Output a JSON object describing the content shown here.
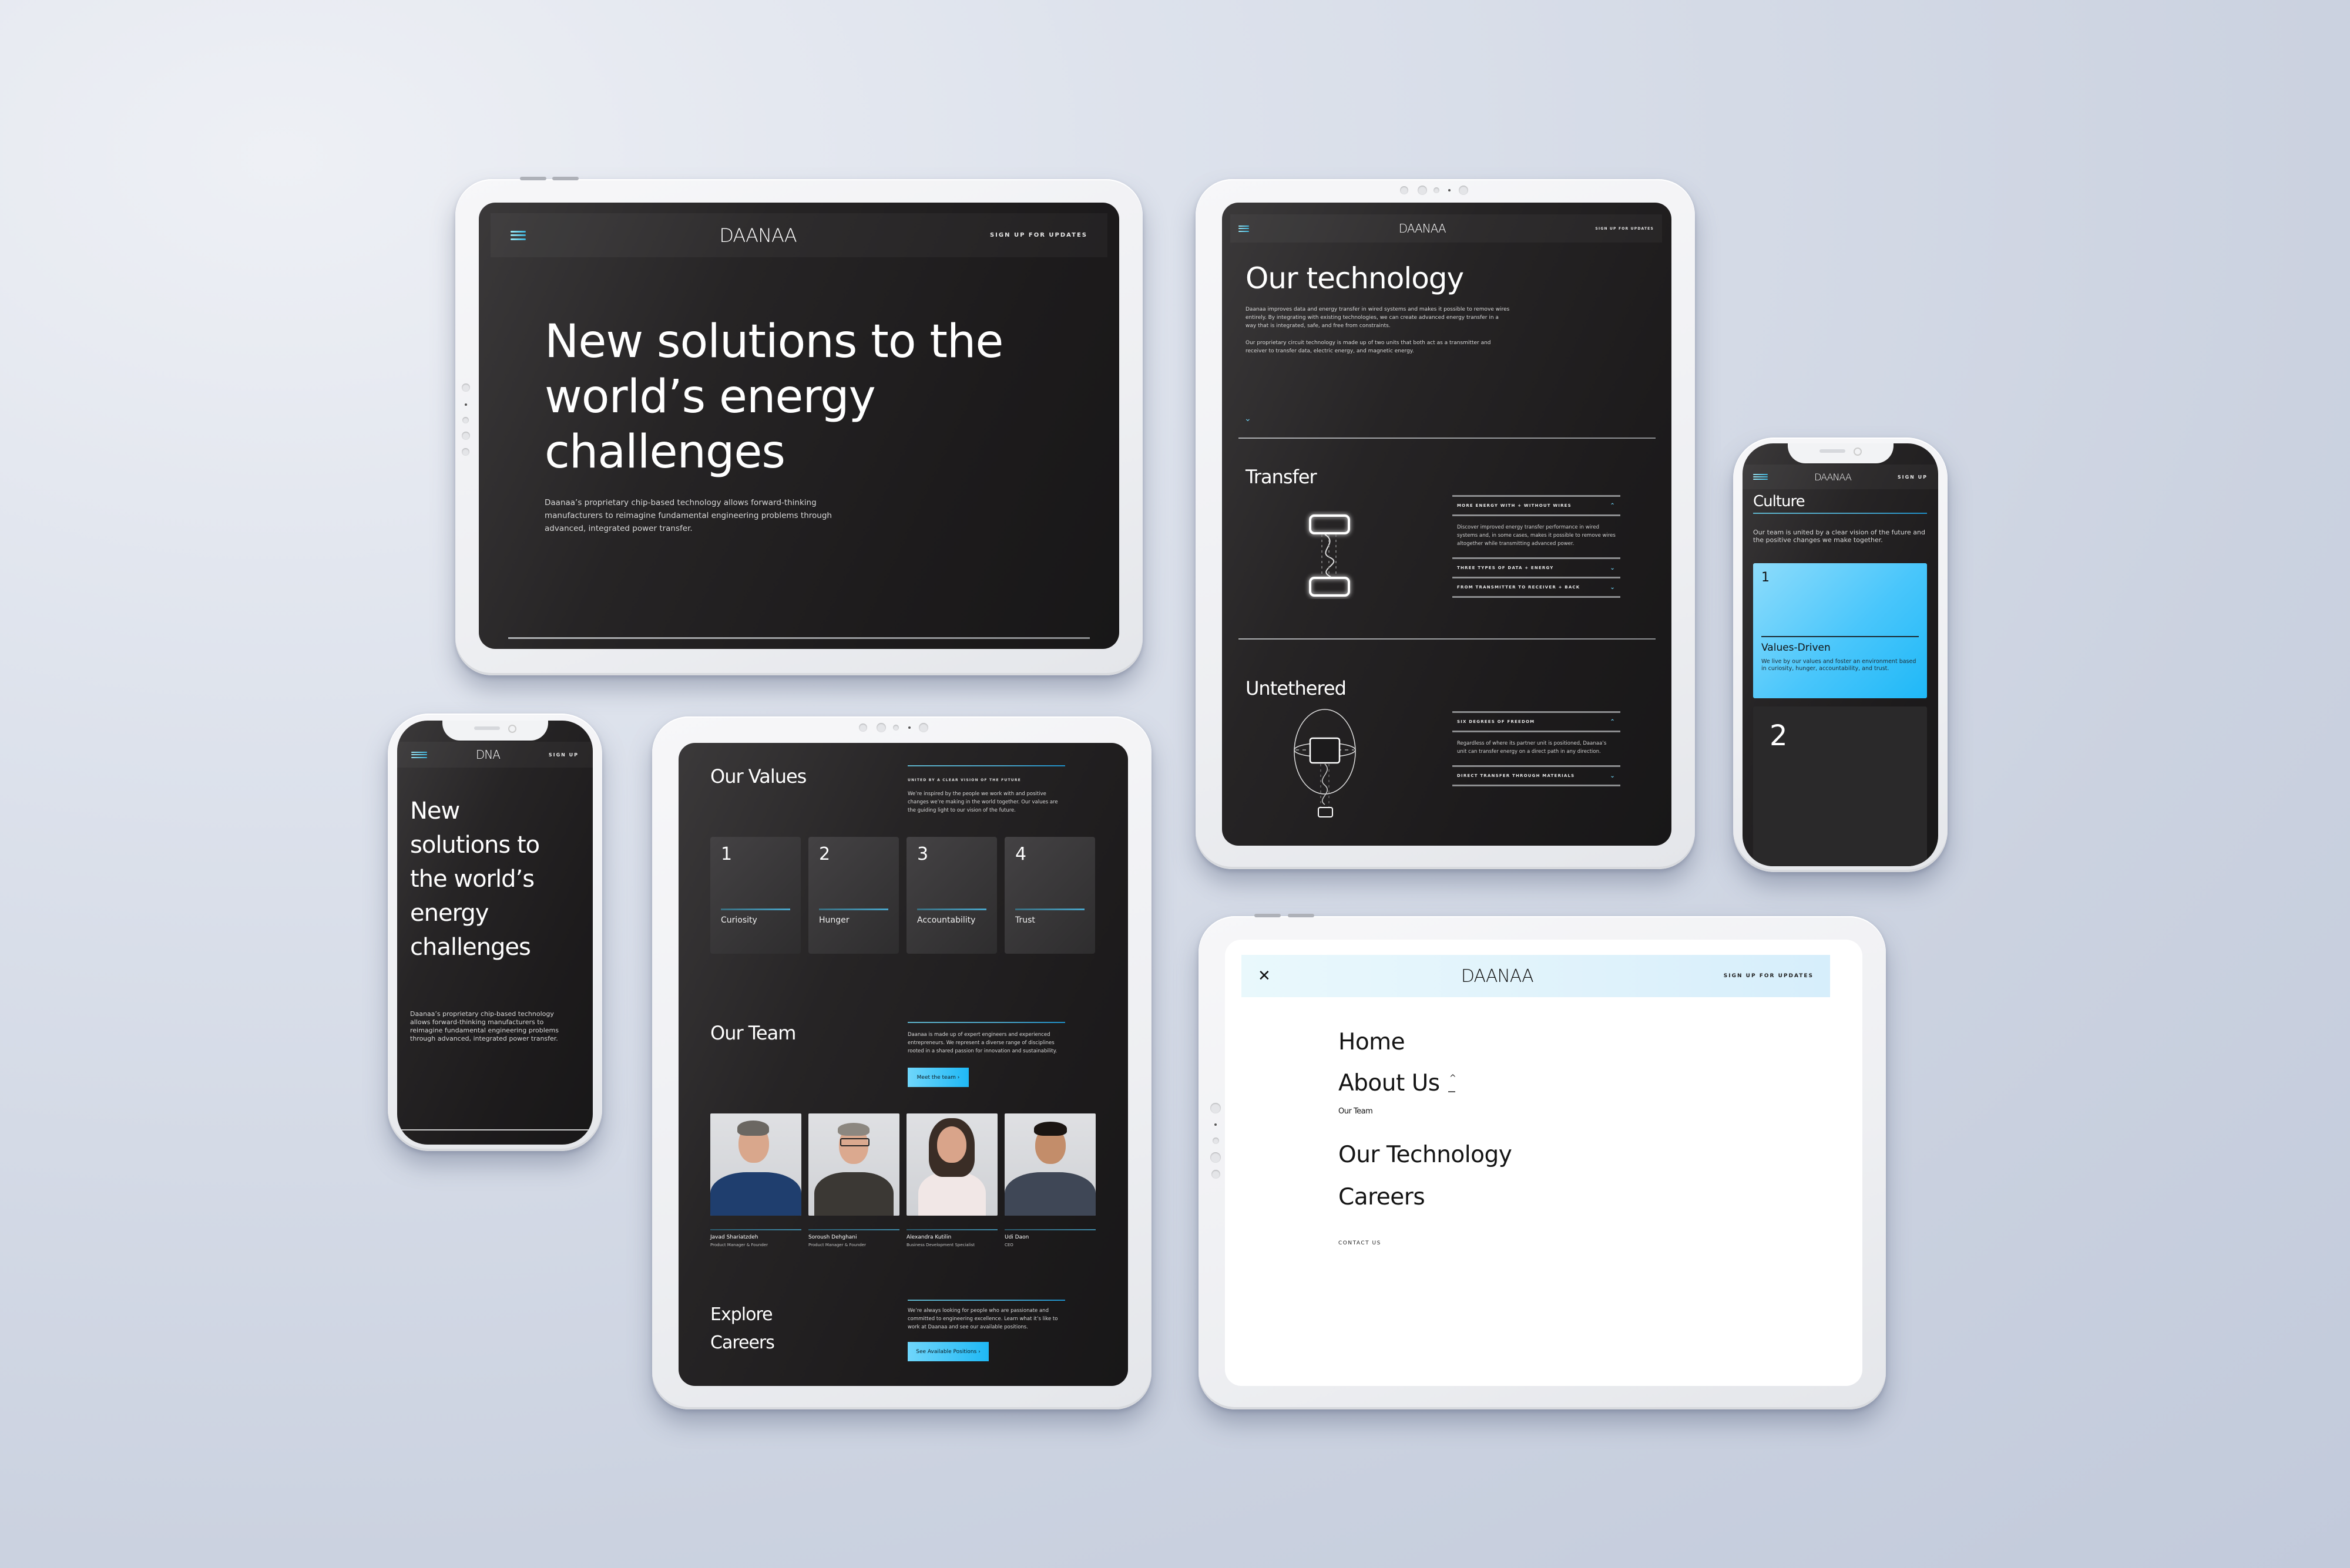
{
  "brand": {
    "logo_text": "DAANAA",
    "logo_compact": "DNA",
    "accent_color": "#2bbcf2",
    "accent_gradient_light": "#6fd6fb",
    "dark_bg": "#1d1b1c",
    "mock_bg": "#cbd2e0"
  },
  "nav": {
    "menu_icon": "hamburger-icon",
    "signup_label": "SIGN UP FOR UPDATES",
    "signup_short": "SIGN UP",
    "close_icon": "close-icon"
  },
  "home_tablet": {
    "headline_lines": [
      "New solutions to the",
      "world’s energy",
      "challenges"
    ],
    "body": "Daanaa’s proprietary chip-based technology allows forward-thinking manufacturers to reimagine fundamental engineering problems through advanced, integrated power transfer."
  },
  "home_phone": {
    "headline_lines": [
      "New",
      "solutions to",
      "the world’s",
      "energy",
      "challenges"
    ],
    "body": "Daanaa’s proprietary chip-based technology allows forward-thinking manufacturers to reimagine fundamental engineering problems through advanced, integrated power transfer."
  },
  "technology": {
    "title": "Our technology",
    "intro_p1": "Daanaa improves data and energy transfer in wired systems and makes it possible to remove wires entirely. By integrating with existing technologies, we can create advanced energy transfer in a way that is integrated, safe, and free from constraints.",
    "intro_p2": "Our proprietary circuit technology is made up of two units that both act as a transmitter and receiver to transfer data, electric energy, and magnetic energy.",
    "scroll_icon": "chevron-down-icon",
    "sections": [
      {
        "title": "Transfer",
        "accordion": [
          {
            "label": "MORE ENERGY WITH + WITHOUT WIRES",
            "expanded": true,
            "body": "Discover improved energy transfer performance in wired systems and, in some cases, makes it possible to remove wires altogether while transmitting advanced power."
          },
          {
            "label": "THREE TYPES OF DATA + ENERGY",
            "expanded": false
          },
          {
            "label": "FROM TRANSMITTER TO RECEIVER + BACK",
            "expanded": false
          }
        ]
      },
      {
        "title": "Untethered",
        "accordion": [
          {
            "label": "SIX DEGREES OF FREEDOM",
            "expanded": true,
            "body": "Regardless of where its partner unit is positioned, Daanaa’s unit can transfer energy on a direct path in any direction."
          },
          {
            "label": "DIRECT TRANSFER THROUGH MATERIALS",
            "expanded": false
          }
        ]
      }
    ]
  },
  "culture_phone": {
    "title": "Culture",
    "body": "Our team is united by a clear vision of the future and the positive changes we make together.",
    "cards": [
      {
        "number": "1",
        "title": "Values-Driven",
        "body": "We live by our values and foster an environment based in curiosity, hunger, accountability, and trust."
      },
      {
        "number": "2"
      }
    ]
  },
  "about": {
    "values_title": "Our Values",
    "values_kicker": "UNITED BY A CLEAR VISION OF THE FUTURE",
    "values_body": "We’re inspired by the people we work with and positive changes we’re making in the world together. Our values are the guiding light to our vision of the future.",
    "values": [
      {
        "number": "1",
        "label": "Curiosity"
      },
      {
        "number": "2",
        "label": "Hunger"
      },
      {
        "number": "3",
        "label": "Accountability"
      },
      {
        "number": "4",
        "label": "Trust"
      }
    ],
    "team_title": "Our Team",
    "team_body": "Daanaa is made up of expert engineers and experienced entrepreneurs. We represent a diverse range of disciplines rooted in a shared passion for innovation and sustainability.",
    "team_button": "Meet the team ›",
    "members": [
      {
        "name": "Javad Shariatzdeh",
        "role": "Product Manager & Founder"
      },
      {
        "name": "Soroush Dehghani",
        "role": "Product Manager & Founder"
      },
      {
        "name": "Alexandra Kutilin",
        "role": "Business Development Specialist"
      },
      {
        "name": "Udi Daon",
        "role": "CEO"
      }
    ],
    "careers_title_lines": [
      "Explore",
      "Careers"
    ],
    "careers_body": "We’re always looking for people who are passionate and committed to engineering excellence. Learn what it’s like to work at Daanaa and see our available positions.",
    "careers_button": "See Available Positions ›"
  },
  "menu": {
    "items": [
      {
        "label": "Home"
      },
      {
        "label": "About Us",
        "expanded": true,
        "toggle": "^",
        "children": [
          "Our Team"
        ]
      },
      {
        "label": "Our Technology"
      },
      {
        "label": "Careers"
      }
    ],
    "contact_label": "CONTACT US"
  }
}
